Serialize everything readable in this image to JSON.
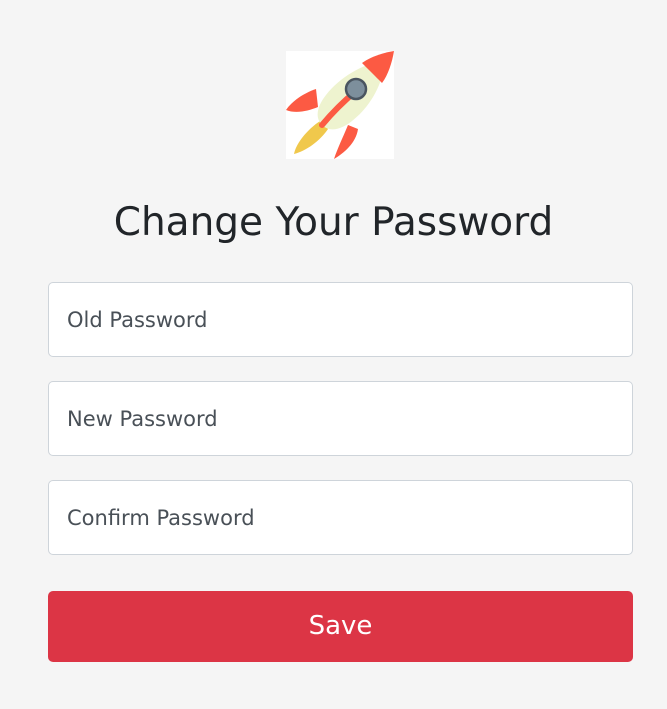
{
  "logo": {
    "icon": "rocket-icon"
  },
  "form": {
    "title": "Change Your Password",
    "old_password": {
      "placeholder": "Old Password",
      "value": ""
    },
    "new_password": {
      "placeholder": "New Password",
      "value": ""
    },
    "confirm_password": {
      "placeholder": "Confirm Password",
      "value": ""
    },
    "save_label": "Save"
  },
  "colors": {
    "background": "#f5f5f5",
    "title_text": "#212529",
    "field_border": "#ced4da",
    "placeholder_text": "#495057",
    "save_button": "#dc3545",
    "save_text": "#ffffff",
    "rocket_body": "#eef3cf",
    "rocket_fins": "#fc5a43",
    "rocket_window": "#7d8f9c",
    "rocket_flame": "#f0c84c"
  }
}
